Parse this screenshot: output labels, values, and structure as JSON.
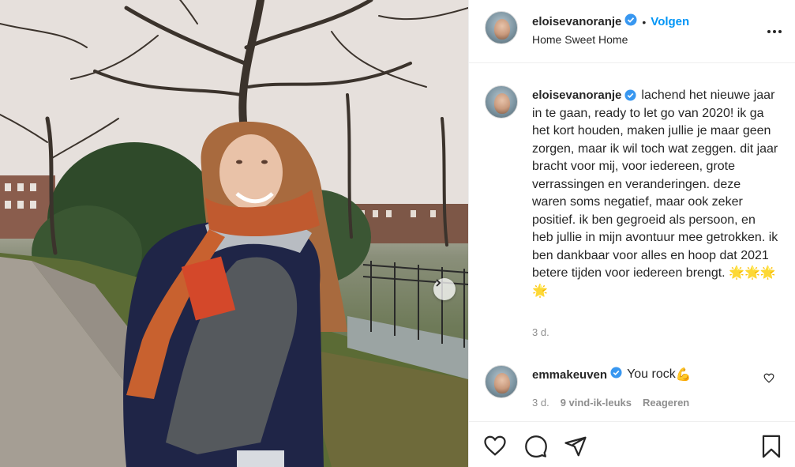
{
  "post": {
    "username": "eloisevanoranje",
    "follow_label": "Volgen",
    "separator": "•",
    "location": "Home Sweet Home",
    "caption": "lachend het nieuwe jaar in te gaan, ready to let go van 2020! ik ga het kort houden, maken jullie je maar geen zorgen, maar ik wil toch wat zeggen. dit jaar bracht voor mij, voor iedereen, grote verrassingen en veranderingen. deze waren soms negatief, maar ook zeker positief. ik ben gegroeid als persoon, en heb jullie in mijn avontuur mee getrokken. ik ben dankbaar voor alles en hoop dat 2021 betere tijden voor iedereen brengt.",
    "caption_emoji": "🌟🌟🌟🌟",
    "caption_time": "3 d."
  },
  "comment": {
    "username": "emmakeuven",
    "text": "You rock",
    "emoji": "💪",
    "time": "3 d.",
    "likes": "9 vind-ik-leuks",
    "reply_label": "Reageren"
  },
  "icons": {
    "verified": "verified-badge-icon",
    "more": "more-options-icon",
    "like": "heart-icon",
    "comment": "comment-icon",
    "share": "share-icon",
    "save": "bookmark-icon",
    "next": "chevron-right-icon"
  },
  "colors": {
    "accent": "#0095f6",
    "text": "#262626",
    "muted": "#8e8e8e",
    "border": "#efefef"
  }
}
